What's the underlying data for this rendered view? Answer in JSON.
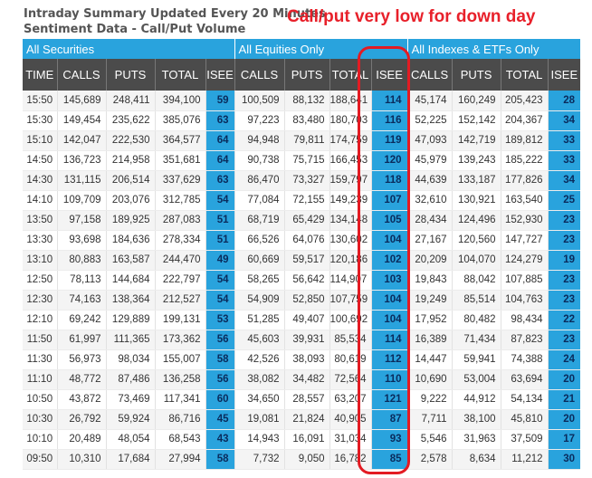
{
  "header": {
    "line1": "Intraday Summary Updated Every 20 Minutes",
    "line2": "Sentiment Data - Call/Put Volume"
  },
  "annotation": "Call/put very low for down day",
  "groups": [
    "All Securities",
    "All Equities Only",
    "All Indexes & ETFs Only"
  ],
  "columns": [
    "TIME",
    "CALLS",
    "PUTS",
    "TOTAL",
    "ISEE",
    "CALLS",
    "PUTS",
    "TOTAL",
    "ISEE",
    "CALLS",
    "PUTS",
    "TOTAL",
    "ISEE"
  ],
  "rows": [
    [
      "15:50",
      "145,689",
      "248,411",
      "394,100",
      "59",
      "100,509",
      "88,132",
      "188,641",
      "114",
      "45,174",
      "160,249",
      "205,423",
      "28"
    ],
    [
      "15:30",
      "149,454",
      "235,622",
      "385,076",
      "63",
      "97,223",
      "83,480",
      "180,703",
      "116",
      "52,225",
      "152,142",
      "204,367",
      "34"
    ],
    [
      "15:10",
      "142,047",
      "222,530",
      "364,577",
      "64",
      "94,948",
      "79,811",
      "174,759",
      "119",
      "47,093",
      "142,719",
      "189,812",
      "33"
    ],
    [
      "14:50",
      "136,723",
      "214,958",
      "351,681",
      "64",
      "90,738",
      "75,715",
      "166,453",
      "120",
      "45,979",
      "139,243",
      "185,222",
      "33"
    ],
    [
      "14:30",
      "131,115",
      "206,514",
      "337,629",
      "63",
      "86,470",
      "73,327",
      "159,797",
      "118",
      "44,639",
      "133,187",
      "177,826",
      "34"
    ],
    [
      "14:10",
      "109,709",
      "203,076",
      "312,785",
      "54",
      "77,084",
      "72,155",
      "149,239",
      "107",
      "32,610",
      "130,921",
      "163,540",
      "25"
    ],
    [
      "13:50",
      "97,158",
      "189,925",
      "287,083",
      "51",
      "68,719",
      "65,429",
      "134,148",
      "105",
      "28,434",
      "124,496",
      "152,930",
      "23"
    ],
    [
      "13:30",
      "93,698",
      "184,636",
      "278,334",
      "51",
      "66,526",
      "64,076",
      "130,602",
      "104",
      "27,167",
      "120,560",
      "147,727",
      "23"
    ],
    [
      "13:10",
      "80,883",
      "163,587",
      "244,470",
      "49",
      "60,669",
      "59,517",
      "120,186",
      "102",
      "20,209",
      "104,070",
      "124,279",
      "19"
    ],
    [
      "12:50",
      "78,113",
      "144,684",
      "222,797",
      "54",
      "58,265",
      "56,642",
      "114,907",
      "103",
      "19,843",
      "88,042",
      "107,885",
      "23"
    ],
    [
      "12:30",
      "74,163",
      "138,364",
      "212,527",
      "54",
      "54,909",
      "52,850",
      "107,759",
      "104",
      "19,249",
      "85,514",
      "104,763",
      "23"
    ],
    [
      "12:10",
      "69,242",
      "129,889",
      "199,131",
      "53",
      "51,285",
      "49,407",
      "100,692",
      "104",
      "17,952",
      "80,482",
      "98,434",
      "22"
    ],
    [
      "11:50",
      "61,997",
      "111,365",
      "173,362",
      "56",
      "45,603",
      "39,931",
      "85,534",
      "114",
      "16,389",
      "71,434",
      "87,823",
      "23"
    ],
    [
      "11:30",
      "56,973",
      "98,034",
      "155,007",
      "58",
      "42,526",
      "38,093",
      "80,619",
      "112",
      "14,447",
      "59,941",
      "74,388",
      "24"
    ],
    [
      "11:10",
      "48,772",
      "87,486",
      "136,258",
      "56",
      "38,082",
      "34,482",
      "72,564",
      "110",
      "10,690",
      "53,004",
      "63,694",
      "20"
    ],
    [
      "10:50",
      "43,872",
      "73,469",
      "117,341",
      "60",
      "34,650",
      "28,557",
      "63,207",
      "121",
      "9,222",
      "44,912",
      "54,134",
      "21"
    ],
    [
      "10:30",
      "26,792",
      "59,924",
      "86,716",
      "45",
      "19,081",
      "21,824",
      "40,905",
      "87",
      "7,711",
      "38,100",
      "45,810",
      "20"
    ],
    [
      "10:10",
      "20,489",
      "48,054",
      "68,543",
      "43",
      "14,943",
      "16,091",
      "31,034",
      "93",
      "5,546",
      "31,963",
      "37,509",
      "17"
    ],
    [
      "09:50",
      "10,310",
      "17,684",
      "27,994",
      "58",
      "7,732",
      "9,050",
      "16,782",
      "85",
      "2,578",
      "8,634",
      "11,212",
      "30"
    ]
  ],
  "colors": {
    "group_bar": "#29a3dd",
    "column_header": "#4b4b4b",
    "isee_cell": "#29a3dd",
    "highlight": "#e31b23"
  }
}
